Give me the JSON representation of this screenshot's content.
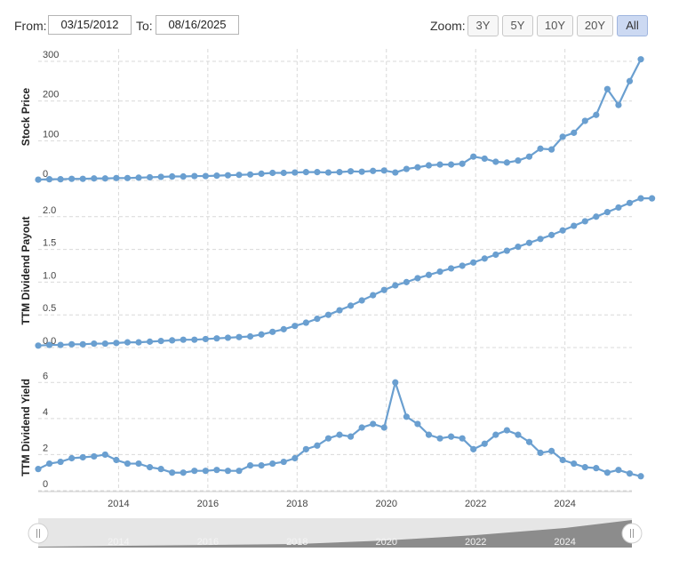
{
  "toolbar": {
    "from_label": "From:",
    "from_value": "03/15/2012",
    "to_label": "To:",
    "to_value": "08/16/2025",
    "zoom_label": "Zoom:",
    "zoom_options": [
      "3Y",
      "5Y",
      "10Y",
      "20Y",
      "All"
    ],
    "zoom_selected": "All"
  },
  "colors": {
    "series": "#6a9fd0",
    "grid": "#d9d9d9",
    "navigator_fill": "#8c8c8c",
    "navigator_mask": "#e6e6e6"
  },
  "chart_data": [
    {
      "type": "line",
      "ylabel": "Stock Price",
      "yticks": [
        0,
        100,
        200,
        300
      ],
      "ylim": [
        0,
        320
      ],
      "x": [
        2012.2,
        2012.45,
        2012.7,
        2012.95,
        2013.2,
        2013.45,
        2013.7,
        2013.95,
        2014.2,
        2014.45,
        2014.7,
        2014.95,
        2015.2,
        2015.45,
        2015.7,
        2015.95,
        2016.2,
        2016.45,
        2016.7,
        2016.95,
        2017.2,
        2017.45,
        2017.7,
        2017.95,
        2018.2,
        2018.45,
        2018.7,
        2018.95,
        2019.2,
        2019.45,
        2019.7,
        2019.95,
        2020.2,
        2020.45,
        2020.7,
        2020.95,
        2021.2,
        2021.45,
        2021.7,
        2021.95,
        2022.2,
        2022.45,
        2022.7,
        2022.95,
        2023.2,
        2023.45,
        2023.7,
        2023.95,
        2024.2,
        2024.45,
        2024.7,
        2024.95,
        2025.2,
        2025.45
      ],
      "values": [
        2,
        3,
        3,
        4,
        4,
        5,
        5,
        6,
        6,
        7,
        8,
        9,
        10,
        10,
        11,
        11,
        12,
        13,
        14,
        15,
        17,
        19,
        19,
        20,
        21,
        21,
        20,
        21,
        23,
        22,
        24,
        25,
        20,
        29,
        33,
        38,
        40,
        40,
        42,
        60,
        55,
        47,
        45,
        50,
        60,
        80,
        78,
        110,
        120,
        150,
        165,
        230,
        190,
        250,
        305
      ],
      "xticks": [
        2014,
        2016,
        2018,
        2020,
        2022,
        2024
      ]
    },
    {
      "type": "line",
      "ylabel": "TTM Dividend Payout",
      "yticks": [
        0.0,
        0.5,
        1.0,
        1.5,
        2.0
      ],
      "ylim": [
        0,
        2.35
      ],
      "x": [
        2012.2,
        2012.45,
        2012.7,
        2012.95,
        2013.2,
        2013.45,
        2013.7,
        2013.95,
        2014.2,
        2014.45,
        2014.7,
        2014.95,
        2015.2,
        2015.45,
        2015.7,
        2015.95,
        2016.2,
        2016.45,
        2016.7,
        2016.95,
        2017.2,
        2017.45,
        2017.7,
        2017.95,
        2018.2,
        2018.45,
        2018.7,
        2018.95,
        2019.2,
        2019.45,
        2019.7,
        2019.95,
        2020.2,
        2020.45,
        2020.7,
        2020.95,
        2021.2,
        2021.45,
        2021.7,
        2021.95,
        2022.2,
        2022.45,
        2022.7,
        2022.95,
        2023.2,
        2023.45,
        2023.7,
        2023.95,
        2024.2,
        2024.45,
        2024.7,
        2024.95,
        2025.2,
        2025.45
      ],
      "values": [
        0.03,
        0.04,
        0.04,
        0.05,
        0.05,
        0.06,
        0.06,
        0.07,
        0.08,
        0.08,
        0.09,
        0.1,
        0.11,
        0.12,
        0.12,
        0.13,
        0.14,
        0.15,
        0.16,
        0.17,
        0.2,
        0.24,
        0.28,
        0.33,
        0.38,
        0.44,
        0.5,
        0.57,
        0.64,
        0.72,
        0.8,
        0.88,
        0.95,
        1.0,
        1.06,
        1.11,
        1.16,
        1.21,
        1.25,
        1.3,
        1.36,
        1.42,
        1.48,
        1.54,
        1.6,
        1.66,
        1.72,
        1.79,
        1.86,
        1.93,
        2.0,
        2.07,
        2.14,
        2.21,
        2.28,
        2.28
      ]
    },
    {
      "type": "line",
      "ylabel": "TTM Dividend Yield",
      "yticks": [
        0,
        2,
        4,
        6
      ],
      "ylim": [
        0,
        7
      ],
      "x": [
        2012.2,
        2012.45,
        2012.7,
        2012.95,
        2013.2,
        2013.45,
        2013.7,
        2013.95,
        2014.2,
        2014.45,
        2014.7,
        2014.95,
        2015.2,
        2015.45,
        2015.7,
        2015.95,
        2016.2,
        2016.45,
        2016.7,
        2016.95,
        2017.2,
        2017.45,
        2017.7,
        2017.95,
        2018.2,
        2018.45,
        2018.7,
        2018.95,
        2019.2,
        2019.45,
        2019.7,
        2019.95,
        2020.2,
        2020.45,
        2020.7,
        2020.95,
        2021.2,
        2021.45,
        2021.7,
        2021.95,
        2022.2,
        2022.45,
        2022.7,
        2022.95,
        2023.2,
        2023.45,
        2023.7,
        2023.95,
        2024.2,
        2024.45,
        2024.7,
        2024.95,
        2025.2,
        2025.45
      ],
      "values": [
        1.2,
        1.5,
        1.6,
        1.8,
        1.85,
        1.9,
        2.0,
        1.7,
        1.5,
        1.5,
        1.3,
        1.2,
        1.0,
        1.0,
        1.1,
        1.1,
        1.15,
        1.1,
        1.1,
        1.4,
        1.4,
        1.5,
        1.6,
        1.8,
        2.3,
        2.5,
        2.9,
        3.1,
        3.0,
        3.5,
        3.7,
        3.5,
        6.0,
        4.1,
        3.7,
        3.1,
        2.9,
        3.0,
        2.9,
        2.3,
        2.6,
        3.1,
        3.35,
        3.1,
        2.7,
        2.1,
        2.2,
        1.7,
        1.5,
        1.3,
        1.25,
        1.0,
        1.15,
        0.95,
        0.8
      ]
    }
  ],
  "navigator": {
    "xticks": [
      2014,
      2016,
      2018,
      2020,
      2022,
      2024
    ]
  }
}
